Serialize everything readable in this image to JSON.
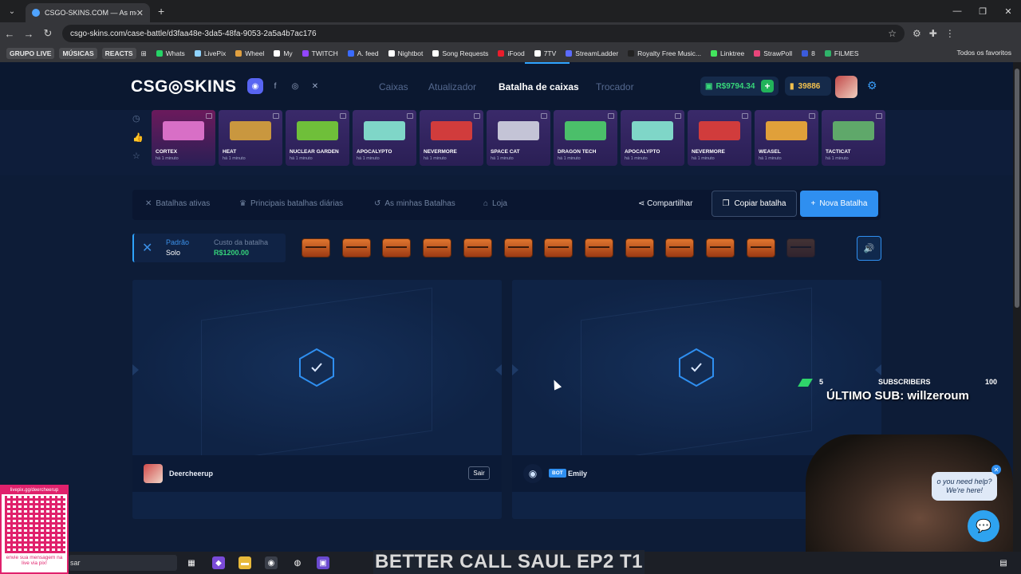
{
  "browser": {
    "tab_title": "CSGO-SKINS.COM — As melhores",
    "url": "csgo-skins.com/case-battle/d3faa48e-3da5-48fa-9053-2a5a4b7ac176",
    "bookmarks": [
      {
        "label": "GRUPO LIVE",
        "boxed": true
      },
      {
        "label": "MÚSICAS",
        "boxed": true
      },
      {
        "label": "REACTS",
        "boxed": true
      },
      {
        "label": "Whats",
        "color": "#25d366"
      },
      {
        "label": "LivePix",
        "color": "#8fd3ff"
      },
      {
        "label": "Wheel",
        "color": "#e0a040"
      },
      {
        "label": "My",
        "color": "#ffffff"
      },
      {
        "label": "TWITCH",
        "color": "#9146ff"
      },
      {
        "label": "A. feed",
        "color": "#3a6bff"
      },
      {
        "label": "Nightbot",
        "color": "#ffffff"
      },
      {
        "label": "Song Requests",
        "color": "#ffffff"
      },
      {
        "label": "iFood",
        "color": "#ea1d2c"
      },
      {
        "label": "7TV",
        "color": "#ffffff"
      },
      {
        "label": "StreamLadder",
        "color": "#5b6bff"
      },
      {
        "label": "Royalty Free Music...",
        "color": "#222222"
      },
      {
        "label": "Linktree",
        "color": "#43e55e"
      },
      {
        "label": "StrawPoll",
        "color": "#e8457a"
      },
      {
        "label": "8",
        "color": "#3b5bdb"
      },
      {
        "label": "FILMES",
        "color": "#2fb36a"
      }
    ],
    "all_favorites": "Todos os favoritos"
  },
  "site": {
    "logo": "CSG◎SKINS",
    "nav": {
      "cases": "Caixas",
      "upgrader": "Atualizador",
      "battles": "Batalha de caixas",
      "trade": "Trocador"
    },
    "balance": "R$9794.34",
    "coins": "39886"
  },
  "live_drops": [
    {
      "name": "CORTEX",
      "time": "há 1 minuto",
      "bg": "#6b1a5c",
      "gun": "#d86fc6"
    },
    {
      "name": "HEAT",
      "time": "há 1 minuto",
      "bg": "#3a2a6a",
      "gun": "#c9973f"
    },
    {
      "name": "NUCLEAR GARDEN",
      "time": "há 1 minuto",
      "bg": "#3a2a6a",
      "gun": "#6fbf3a"
    },
    {
      "name": "APOCALYPTO",
      "time": "há 1 minuto",
      "bg": "#3a2a6a",
      "gun": "#7fd6c8"
    },
    {
      "name": "NEVERMORE",
      "time": "há 1 minuto",
      "bg": "#3a2a6a",
      "gun": "#d13c3c"
    },
    {
      "name": "SPACE CAT",
      "time": "há 1 minuto",
      "bg": "#3a2a6a",
      "gun": "#c4c4d6"
    },
    {
      "name": "DRAGON TECH",
      "time": "há 1 minuto",
      "bg": "#3a2a6a",
      "gun": "#4bbf6a"
    },
    {
      "name": "APOCALYPTO",
      "time": "há 1 minuto",
      "bg": "#3a2a6a",
      "gun": "#7fd6c8"
    },
    {
      "name": "NEVERMORE",
      "time": "há 1 minuto",
      "bg": "#3a2a6a",
      "gun": "#d13c3c"
    },
    {
      "name": "WEASEL",
      "time": "há 1 minuto",
      "bg": "#3a2a6a",
      "gun": "#e0a03a"
    },
    {
      "name": "TACTICAT",
      "time": "há 1 minuto",
      "bg": "#3a2a6a",
      "gun": "#5fa86a"
    }
  ],
  "actions": {
    "active": "Batalhas ativas",
    "top_daily": "Principais batalhas diárias",
    "mine": "As minhas Batalhas",
    "shop": "Loja",
    "share": "Compartilhar",
    "copy": "Copiar batalha",
    "new": "Nova Batalha"
  },
  "battle": {
    "mode_label": "Padrão",
    "mode_value": "Solo",
    "cost_label": "Custo da batalha",
    "cost_value": "R$1200.00",
    "case_count": 13,
    "players": [
      {
        "name": "Deercheerup",
        "leave": "Sair"
      },
      {
        "badge": "BOT",
        "name": "Emily"
      }
    ]
  },
  "stream": {
    "sub_current": "5",
    "sub_label": "SUBSCRIBERS",
    "sub_goal": "100",
    "sub_progress": 0.05,
    "last_sub": "ÚLTIMO SUB: willzeroum",
    "help_line1": "o you need help?",
    "help_line2": "We're here!",
    "qr_top": "livepix.gg/deercheerup",
    "qr_bottom": "envie sua mensagem na live via pix!",
    "ticker": "BETTER CALL SAUL EP2 T1",
    "taskbar_search": "sar"
  }
}
